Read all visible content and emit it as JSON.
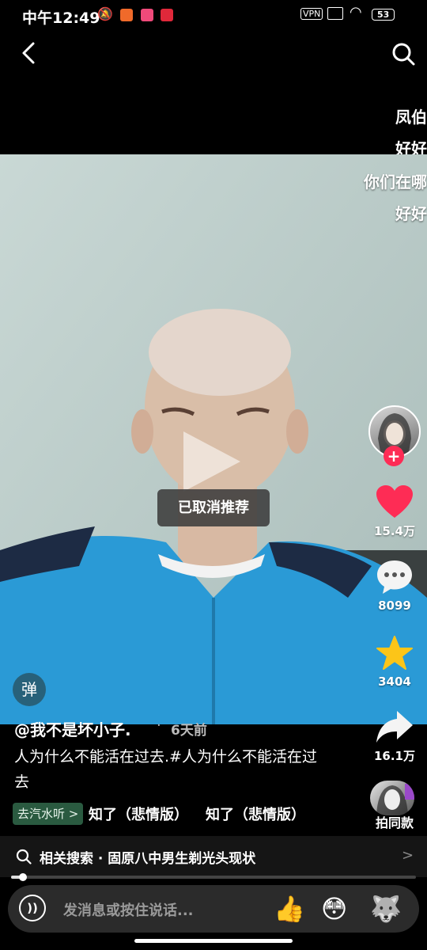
{
  "status_bar": {
    "time": "中午12:49",
    "vpn": "VPN",
    "battery": "53"
  },
  "danmaku": [
    "凤伯",
    "好好",
    "你们在哪",
    "好好"
  ],
  "toast": "已取消推荐",
  "danmu_toggle": "弹",
  "right_column": {
    "likes": "15.4万",
    "comments": "8099",
    "favorites": "3404",
    "shares": "16.1万",
    "same_style": "拍同款"
  },
  "post": {
    "author": "@我不是坏小子.",
    "dot": "·",
    "time": "6天前",
    "description": "人为什么不能活在过去.#人为什么不能活在过去",
    "music_pill": "去汽水听",
    "music_chevron": ">",
    "music_title_1": "知了（悲情版）",
    "music_title_2": "知了（悲情版）"
  },
  "related_search": {
    "label": "相关搜索 · 固原八中男生剃光头现状",
    "chevron": ">"
  },
  "progress": {
    "fraction": 0.03
  },
  "input": {
    "placeholder": "发消息或按住说话..."
  }
}
